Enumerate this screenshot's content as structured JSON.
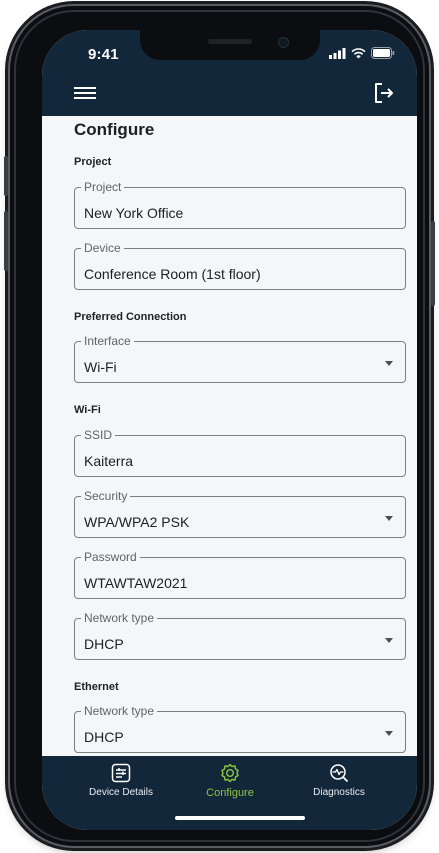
{
  "status_bar": {
    "time": "9:41"
  },
  "header": {
    "menu_icon": "hamburger-menu-icon",
    "logout_icon": "logout-icon"
  },
  "page": {
    "title": "Configure"
  },
  "sections": {
    "project": "Project",
    "preferred_connection": "Preferred Connection",
    "wifi": "Wi-Fi",
    "ethernet": "Ethernet"
  },
  "fields": {
    "project": {
      "label": "Project",
      "value": "New York Office"
    },
    "device": {
      "label": "Device",
      "value": "Conference Room (1st floor)"
    },
    "interface": {
      "label": "Interface",
      "value": "Wi-Fi"
    },
    "ssid": {
      "label": "SSID",
      "value": "Kaiterra"
    },
    "security": {
      "label": "Security",
      "value": "WPA/WPA2 PSK"
    },
    "password": {
      "label": "Password",
      "value": "WTAWTAW2021"
    },
    "wifi_network_type": {
      "label": "Network type",
      "value": "DHCP"
    },
    "ethernet_network_type": {
      "label": "Network type",
      "value": "DHCP"
    }
  },
  "tabs": [
    {
      "label": "Device Details",
      "icon": "device-details-icon",
      "active": false
    },
    {
      "label": "Configure",
      "icon": "gear-icon",
      "active": true
    },
    {
      "label": "Diagnostics",
      "icon": "diagnostics-icon",
      "active": false
    }
  ],
  "colors": {
    "header_bg": "#13273b",
    "accent": "#8cc63f",
    "background": "#f5f6f7"
  }
}
